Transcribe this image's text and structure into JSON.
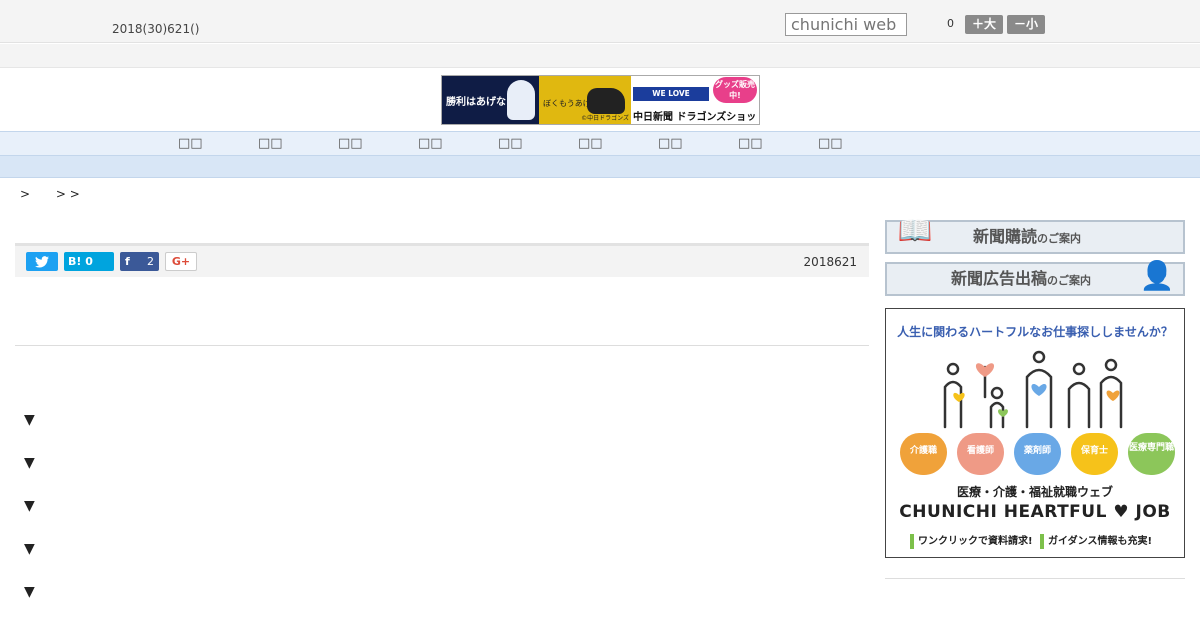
{
  "header": {
    "date": "2018(30)621()",
    "search_placeholder": "chunichi web",
    "font_count": "0",
    "font_big_label": "＋大",
    "font_small_label": "－小"
  },
  "banner": {
    "text1": "勝利はあげない",
    "text2": "ぼくもうあげる",
    "note": "©中日ドラゴンズ",
    "welove": "WE LOVE DRAGONS",
    "shop": "中日新聞 ドラゴンズショップ",
    "sale": "グッズ販売中!"
  },
  "nav": {
    "items": [
      "□□",
      "□□",
      "□□",
      "□□",
      "□□",
      "□□",
      "□□",
      "□□",
      "□□"
    ]
  },
  "breadcrumb": [
    ">",
    "> >"
  ],
  "social": {
    "twitter": "🐦",
    "hatena": "B! 0",
    "facebook_icon": "f",
    "facebook_count": "2",
    "gplus": "G+",
    "pubdate": "2018621"
  },
  "arrows": [
    "▼",
    "▼",
    "▼",
    "▼",
    "▼"
  ],
  "sidebar": {
    "subscribe_main": "新聞購読",
    "subscribe_tail": "のご案内",
    "ad_main": "新聞広告出稿",
    "ad_tail": "のご案内"
  },
  "heartful": {
    "question": "人生に関わるハートフルなお仕事探ししませんか？",
    "hearts": [
      {
        "label": "介護職",
        "color": "#f0a23a"
      },
      {
        "label": "看護師",
        "color": "#ef9a86"
      },
      {
        "label": "薬剤師",
        "color": "#69a8e6"
      },
      {
        "label": "保育士",
        "color": "#f6c21a"
      },
      {
        "label": "医療専門職",
        "color": "#8cc65a"
      }
    ],
    "line1": "医療・介護・福祉就職ウェブ",
    "line2": "CHUNICHI HEARTFUL ♥ JOB",
    "bullet1": "ワンクリックで資料請求!",
    "bullet2": "ガイダンス情報も充実!"
  }
}
